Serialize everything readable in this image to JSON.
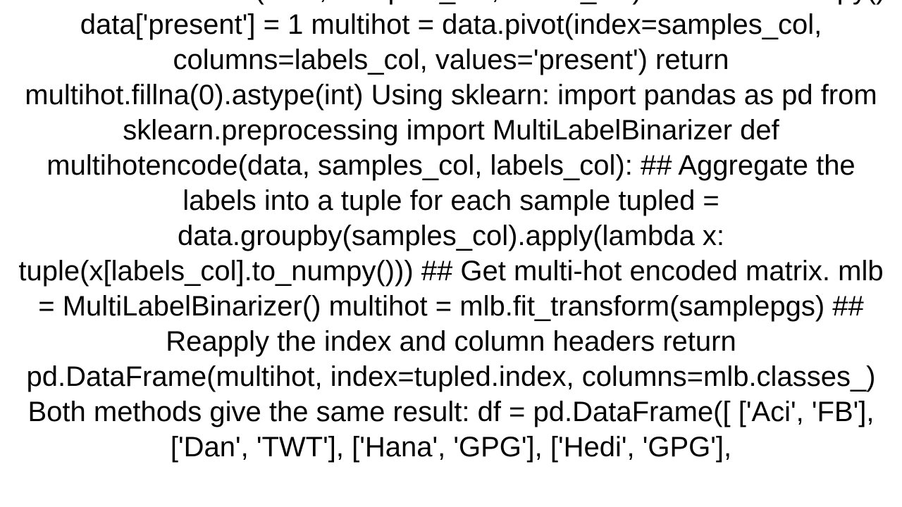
{
  "content": {
    "body_text": "def multihotencode(data, samples_col, labels_col):     data = data.copy()     data['present'] = 1     multihot = data.pivot(index=samples_col, columns=labels_col, values='present')     return multihot.fillna(0).astype(int)  Using sklearn: import pandas as pd from sklearn.preprocessing import MultiLabelBinarizer  def multihotencode(data, samples_col, labels_col):     ## Aggregate the labels into a tuple for each sample     tupled = data.groupby(samples_col).apply(lambda x: tuple(x[labels_col].to_numpy()))     ## Get multi-hot encoded matrix.     mlb = MultiLabelBinarizer()     multihot = mlb.fit_transform(samplepgs)     ## Reapply the index and column headers     return pd.DataFrame(multihot, index=tupled.index, columns=mlb.classes_)  Both methods give the same result: df = pd.DataFrame([     ['Aci', 'FB'],     ['Dan', 'TWT'],     ['Hana', 'GPG'],     ['Hedi', 'GPG'],"
  }
}
